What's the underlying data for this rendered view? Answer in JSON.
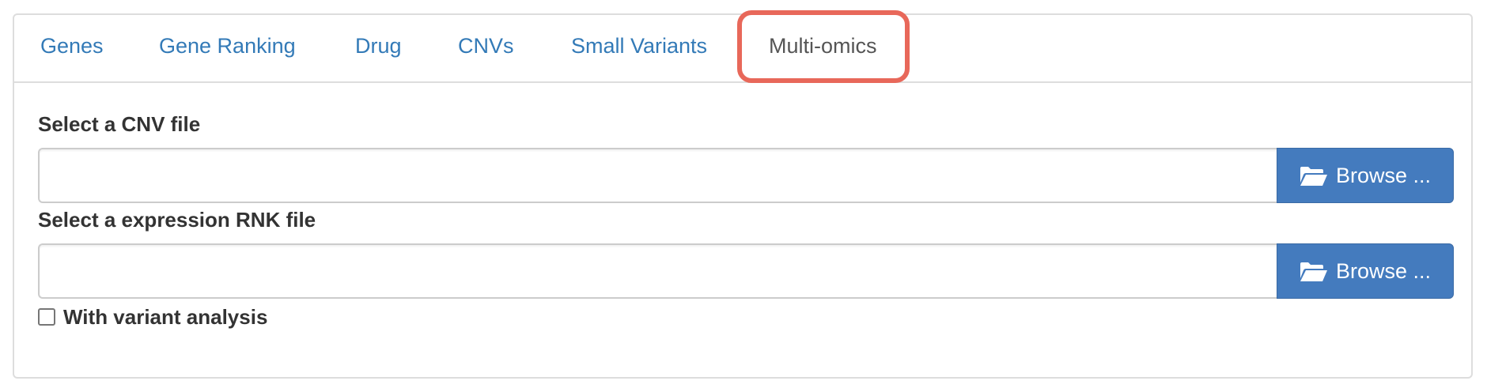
{
  "tabs": [
    {
      "label": "Genes",
      "active": false
    },
    {
      "label": "Gene Ranking",
      "active": false
    },
    {
      "label": "Drug",
      "active": false
    },
    {
      "label": "CNVs",
      "active": false
    },
    {
      "label": "Small Variants",
      "active": false
    },
    {
      "label": "Multi-omics",
      "active": true
    }
  ],
  "cnv_file": {
    "label": "Select a CNV file",
    "value": "",
    "browse_label": "Browse ...",
    "icon": "folder-open-icon"
  },
  "rnk_file": {
    "label": "Select a expression RNK file",
    "value": "",
    "browse_label": "Browse ...",
    "icon": "folder-open-icon"
  },
  "variant_option": {
    "label": "With variant analysis",
    "checked": false
  },
  "colors": {
    "tab_link": "#337ab7",
    "tab_active": "#555555",
    "highlight_box": "#e8685a",
    "browse_button": "#447bbe"
  }
}
